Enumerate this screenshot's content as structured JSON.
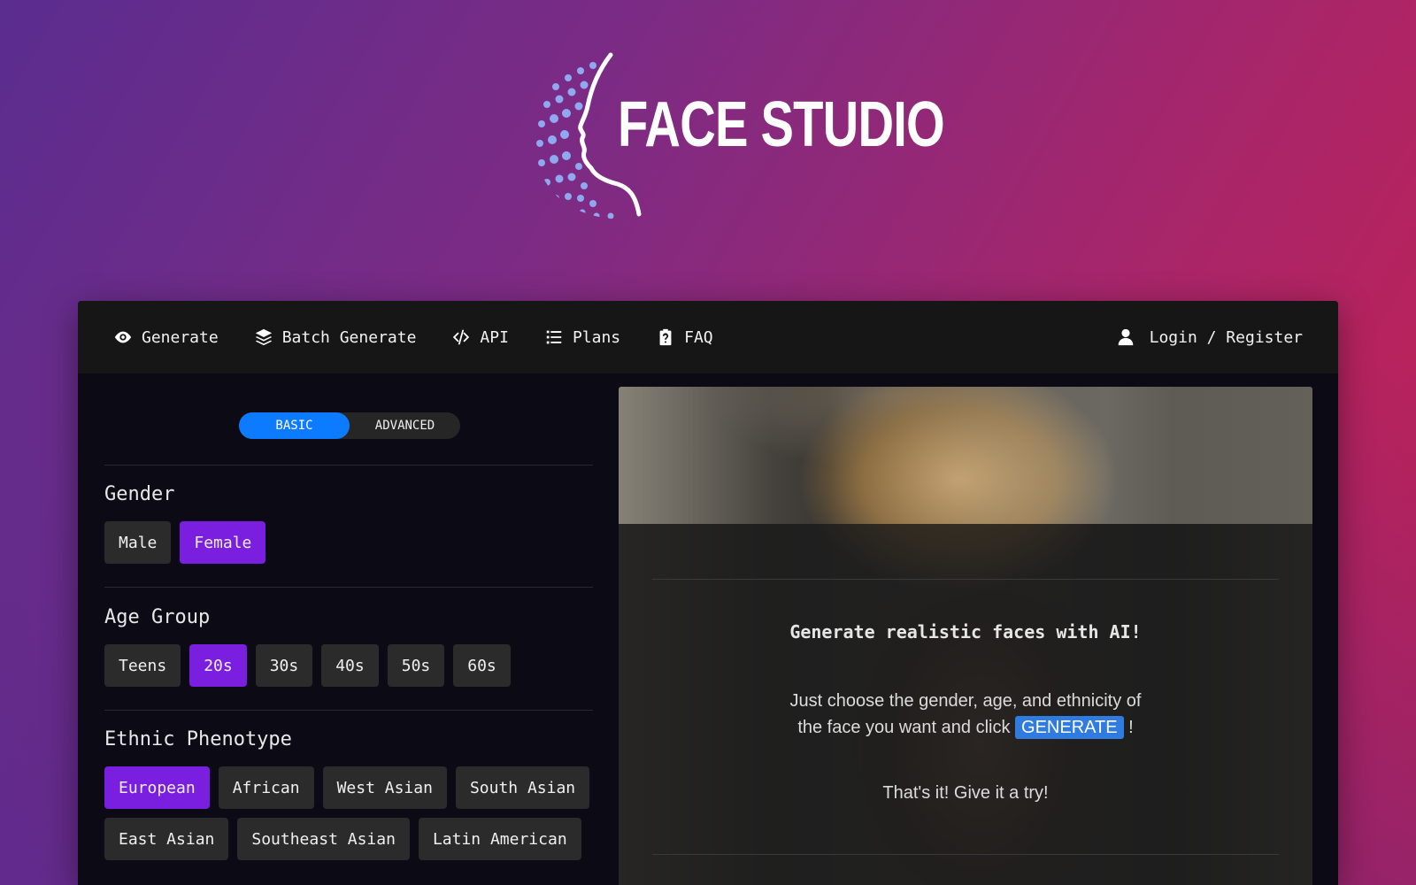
{
  "logo": {
    "text": "FACE STUDIO"
  },
  "nav": {
    "items": [
      {
        "label": "Generate",
        "icon": "eye-icon"
      },
      {
        "label": "Batch Generate",
        "icon": "layers-icon"
      },
      {
        "label": "API",
        "icon": "code-icon"
      },
      {
        "label": "Plans",
        "icon": "list-icon"
      },
      {
        "label": "FAQ",
        "icon": "clipboard-question-icon"
      }
    ],
    "login": {
      "label": "Login / Register",
      "icon": "user-icon"
    }
  },
  "mode_toggle": {
    "basic": "BASIC",
    "advanced": "ADVANCED",
    "selected": "BASIC"
  },
  "gender": {
    "label": "Gender",
    "options": [
      "Male",
      "Female"
    ],
    "selected": "Female"
  },
  "age": {
    "label": "Age Group",
    "options": [
      "Teens",
      "20s",
      "30s",
      "40s",
      "50s",
      "60s"
    ],
    "selected": "20s"
  },
  "ethnicity": {
    "label": "Ethnic Phenotype",
    "options": [
      "European",
      "African",
      "West Asian",
      "South Asian",
      "East Asian",
      "Southeast Asian",
      "Latin American"
    ],
    "selected": "European"
  },
  "preview": {
    "headline": "Generate realistic faces with AI!",
    "desc_line1": "Just choose the gender, age, and ethnicity of",
    "desc_line2_prefix": "the face you want and click",
    "desc_badge": "GENERATE",
    "desc_line2_suffix": "!",
    "tryit": "That's it! Give it a try!"
  },
  "colors": {
    "accent_blue": "#0d7bff",
    "selected_purple": "#7a1fe0",
    "badge_blue": "#2f7be0"
  }
}
